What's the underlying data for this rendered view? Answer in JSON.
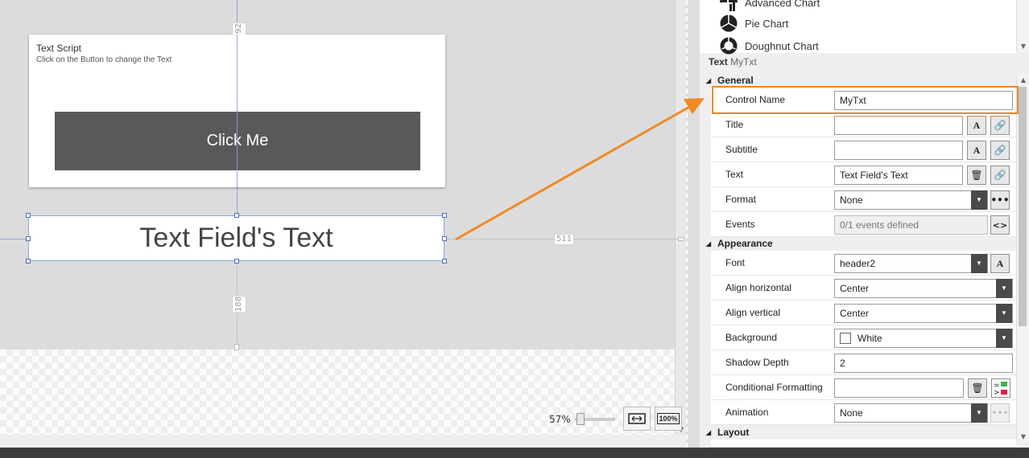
{
  "canvas": {
    "card": {
      "title": "Text Script",
      "subtitle": "Click on the Button to change the Text",
      "button_label": "Click Me"
    },
    "text_field": {
      "text": "Text Field's Text"
    },
    "dimensions": {
      "top": "792",
      "bottom": "188",
      "right": "511"
    },
    "zoom": {
      "label": "57%",
      "actual_size_label": "100%"
    }
  },
  "panel": {
    "chart_list": [
      {
        "label": "Advanced Chart",
        "icon": "advanced-chart-icon"
      },
      {
        "label": "Pie Chart",
        "icon": "pie-chart-icon"
      },
      {
        "label": "Doughnut Chart",
        "icon": "doughnut-chart-icon"
      }
    ],
    "header": {
      "type": "Text",
      "name": "MyTxt"
    },
    "sections": {
      "general": "General",
      "appearance": "Appearance",
      "layout": "Layout"
    },
    "props": {
      "control_name": {
        "label": "Control Name",
        "value": "MyTxt"
      },
      "title": {
        "label": "Title",
        "value": ""
      },
      "subtitle": {
        "label": "Subtitle",
        "value": ""
      },
      "text": {
        "label": "Text",
        "value": "Text Field's Text"
      },
      "format": {
        "label": "Format",
        "value": "None"
      },
      "events": {
        "label": "Events",
        "value": "0/1 events defined"
      },
      "font": {
        "label": "Font",
        "value": "header2"
      },
      "align_horizontal": {
        "label": "Align horizontal",
        "value": "Center"
      },
      "align_vertical": {
        "label": "Align vertical",
        "value": "Center"
      },
      "background": {
        "label": "Background",
        "value": "White"
      },
      "shadow_depth": {
        "label": "Shadow Depth",
        "value": "2"
      },
      "conditional_formatting": {
        "label": "Conditional Formatting",
        "value": ""
      },
      "animation": {
        "label": "Animation",
        "value": "None"
      }
    }
  },
  "colors": {
    "accent_orange": "#f08a24",
    "button_dark": "#595959",
    "dropdown_dark": "#4a4a4a"
  }
}
